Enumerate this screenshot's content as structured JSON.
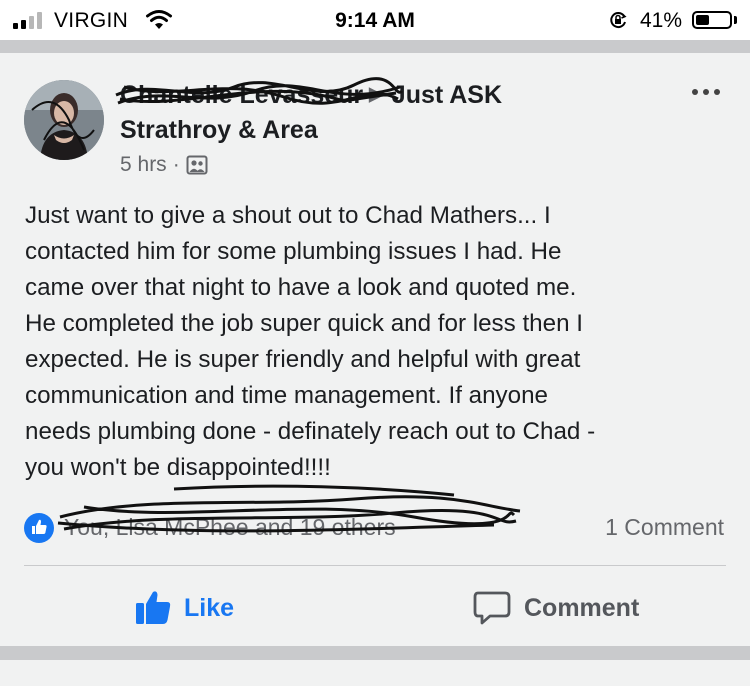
{
  "status_bar": {
    "carrier": "VIRGIN",
    "time": "9:14 AM",
    "battery_percent": "41%",
    "battery_level": 0.41,
    "signal_bars": 2,
    "icons": [
      "signal-bars-icon",
      "wifi-icon",
      "orientation-lock-icon",
      "battery-icon"
    ]
  },
  "post": {
    "author": "Chantelle Levasseur",
    "group_name": "Just ASK",
    "group_name_line2": "Strathroy & Area",
    "arrow": "▶",
    "timestamp": "5 hrs",
    "separator": "·",
    "audience_icon": "group-audience-icon",
    "more_icon": "more-options-icon",
    "text": "Just want to give a shout out to Chad Mathers... I\ncontacted him for some plumbing issues I had.  He\ncame over that night to have a look and quoted me.\nHe completed the job super quick and for less then I\nexpected.  He is super friendly and helpful with great\ncommunication and time management.  If anyone\nneeds plumbing done - definately reach out to Chad -\nyou won't be disappointed!!!!"
  },
  "reactions": {
    "text": "You, Lisa McPhee and 19 others",
    "comments": "1 Comment"
  },
  "actions": {
    "like": "Like",
    "comment": "Comment"
  },
  "colors": {
    "accent": "#1877f2",
    "card_bg": "#f1f2f2",
    "separator_bg": "#c9cacc",
    "secondary_text": "#65676b"
  }
}
